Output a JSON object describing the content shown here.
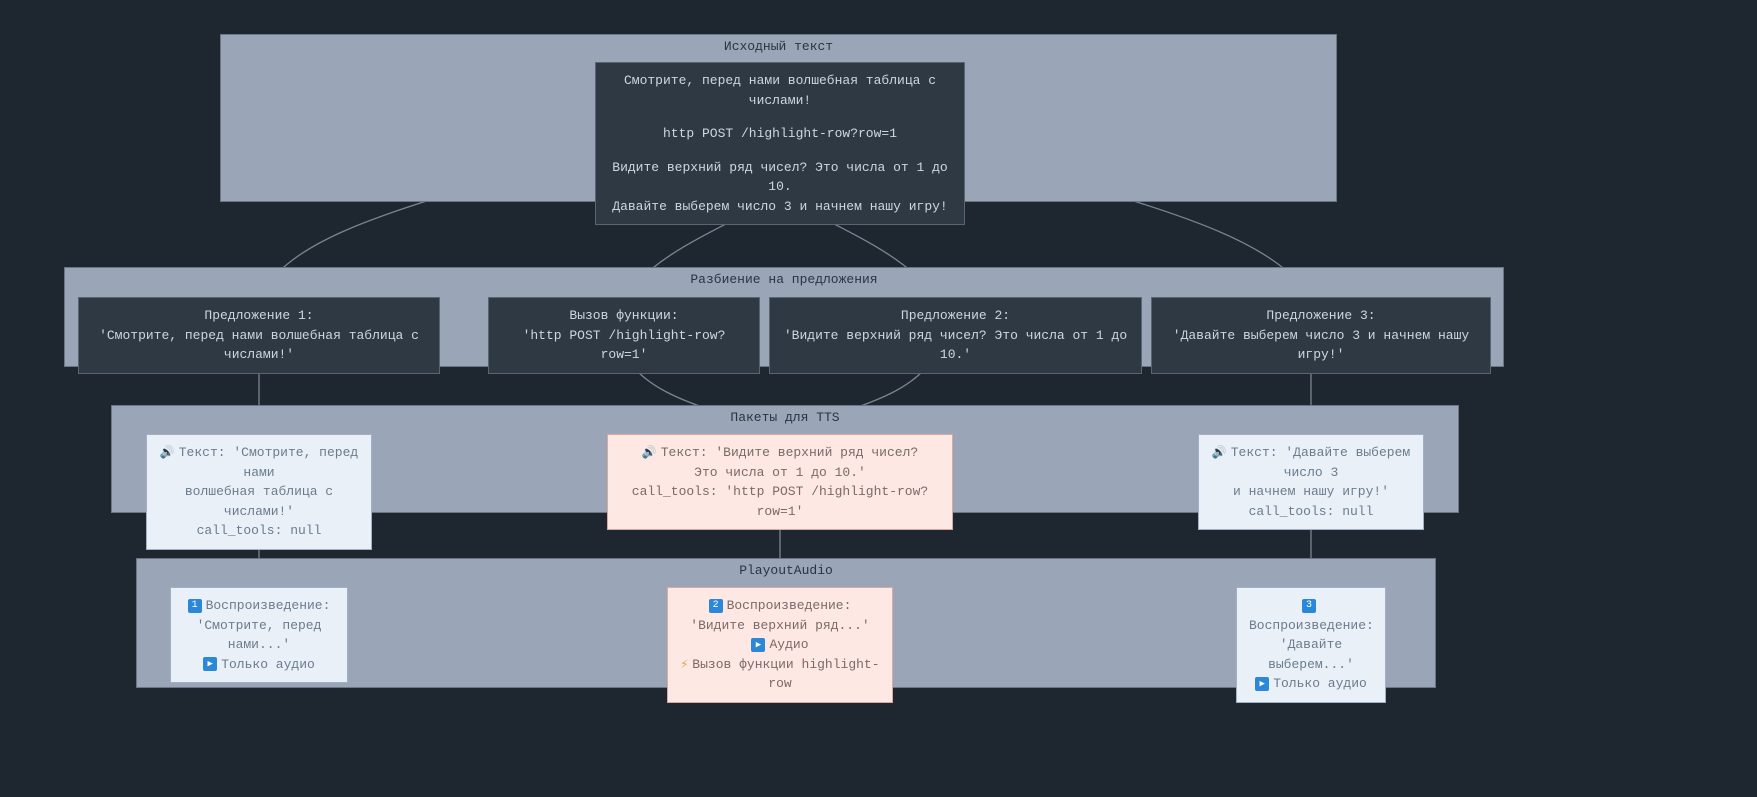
{
  "panels": {
    "source": {
      "title": "Исходный текст"
    },
    "split": {
      "title": "Разбиение на предложения"
    },
    "tts": {
      "title": "Пакеты для TTS"
    },
    "playout": {
      "title": "PlayoutAudio"
    }
  },
  "source_box": {
    "line1": "Смотрите, перед нами волшебная таблица с числами!",
    "line2": "http POST /highlight-row?row=1",
    "line3": "Видите верхний ряд чисел? Это числа от 1 до 10.",
    "line4": "Давайте выберем число 3 и начнем нашу игру!"
  },
  "sentences": [
    {
      "title": "Предложение 1:",
      "text": "'Смотрите, перед нами волшебная таблица с числами!'"
    },
    {
      "title": "Вызов функции:",
      "text": "'http POST /highlight-row?row=1'"
    },
    {
      "title": "Предложение 2:",
      "text": "'Видите верхний ряд чисел? Это числа от 1 до 10.'"
    },
    {
      "title": "Предложение 3:",
      "text": "'Давайте выберем число 3 и начнем нашу игру!'"
    }
  ],
  "packets": [
    {
      "text_label": "Текст: 'Смотрите, перед нами",
      "text_line2": "волшебная таблица с числами!'",
      "calltools": "call_tools: null"
    },
    {
      "text_label": "Текст: 'Видите верхний ряд чисел?",
      "text_line2": "Это числа от 1 до 10.'",
      "calltools": "call_tools: 'http POST /highlight-row?row=1'"
    },
    {
      "text_label": "Текст: 'Давайте выберем число 3",
      "text_line2": "и начнем нашу игру!'",
      "calltools": "call_tools: null"
    }
  ],
  "playouts": [
    {
      "num": "1",
      "title": "Воспроизведение:",
      "text": "'Смотрите, перед нами...'",
      "audio": "Только аудио"
    },
    {
      "num": "2",
      "title": "Воспроизведение:",
      "text": "'Видите верхний ряд...'",
      "audio": "Аудио",
      "func": "Вызов функции highlight-row"
    },
    {
      "num": "3",
      "title": "Воспроизведение:",
      "text": "'Давайте выберем...'",
      "audio": "Только аудио"
    }
  ]
}
